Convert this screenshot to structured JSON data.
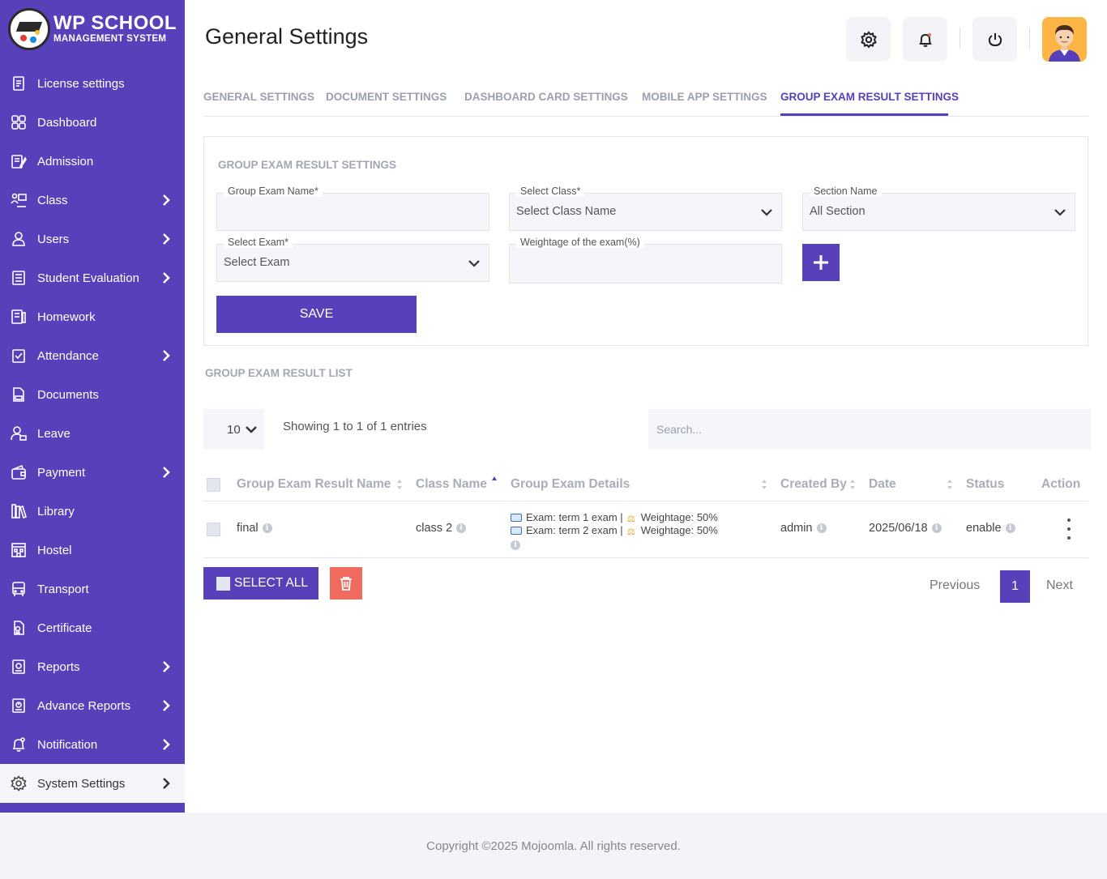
{
  "brand": {
    "title": "WP SCHOOL",
    "subtitle": "MANAGEMENT SYSTEM",
    "accent_color": "#5840bb"
  },
  "sidebar": {
    "items": [
      {
        "label": "License settings",
        "icon": "license-icon",
        "has_children": false
      },
      {
        "label": "Dashboard",
        "icon": "dashboard-icon",
        "has_children": false
      },
      {
        "label": "Admission",
        "icon": "admission-icon",
        "has_children": false
      },
      {
        "label": "Class",
        "icon": "class-icon",
        "has_children": true
      },
      {
        "label": "Users",
        "icon": "user-icon",
        "has_children": true
      },
      {
        "label": "Student Evaluation",
        "icon": "evaluation-icon",
        "has_children": true
      },
      {
        "label": "Homework",
        "icon": "homework-icon",
        "has_children": false
      },
      {
        "label": "Attendance",
        "icon": "attendance-icon",
        "has_children": true
      },
      {
        "label": "Documents",
        "icon": "document-icon",
        "has_children": false
      },
      {
        "label": "Leave",
        "icon": "leave-icon",
        "has_children": false
      },
      {
        "label": "Payment",
        "icon": "wallet-icon",
        "has_children": true
      },
      {
        "label": "Library",
        "icon": "library-icon",
        "has_children": false
      },
      {
        "label": "Hostel",
        "icon": "hostel-icon",
        "has_children": false
      },
      {
        "label": "Transport",
        "icon": "bus-icon",
        "has_children": false
      },
      {
        "label": "Certificate",
        "icon": "certificate-icon",
        "has_children": false
      },
      {
        "label": "Reports",
        "icon": "report-icon",
        "has_children": true
      },
      {
        "label": "Advance Reports",
        "icon": "advance-report-icon",
        "has_children": true
      },
      {
        "label": "Notification",
        "icon": "notification-icon",
        "has_children": true
      },
      {
        "label": "System Settings",
        "icon": "gear-icon",
        "has_children": true,
        "active": true
      }
    ]
  },
  "header": {
    "title": "General Settings"
  },
  "tabs": [
    {
      "label": "GENERAL SETTINGS"
    },
    {
      "label": "DOCUMENT SETTINGS"
    },
    {
      "label": "DASHBOARD CARD SETTINGS"
    },
    {
      "label": "MOBILE APP SETTINGS"
    },
    {
      "label": "GROUP EXAM RESULT SETTINGS",
      "active": true
    }
  ],
  "form": {
    "heading": "GROUP EXAM RESULT SETTINGS",
    "group_exam_name": {
      "label": "Group Exam Name*",
      "value": ""
    },
    "select_class": {
      "label": "Select Class*",
      "value": "Select Class Name"
    },
    "section_name": {
      "label": "Section Name",
      "value": "All Section"
    },
    "select_exam": {
      "label": "Select Exam*",
      "value": "Select Exam"
    },
    "weightage": {
      "label": "Weightage of the exam(%)",
      "value": ""
    },
    "save_label": "SAVE"
  },
  "list": {
    "heading": "GROUP EXAM RESULT LIST",
    "page_length": "10",
    "info": "Showing 1 to 1 of 1 entries",
    "search_placeholder": "Search...",
    "columns": [
      "Group Exam Result Name",
      "Class Name",
      "Group Exam Details",
      "Created By",
      "Date",
      "Status",
      "Action"
    ],
    "rows": [
      {
        "name": "final",
        "class_name": "class 2",
        "details": [
          {
            "exam": "Exam: term 1 exam |",
            "weightage": "Weightage: 50%"
          },
          {
            "exam": "Exam: term 2 exam |",
            "weightage": "Weightage: 50%"
          }
        ],
        "created_by": "admin",
        "date": "2025/06/18",
        "status": "enable"
      }
    ],
    "select_all_label": "SELECT ALL",
    "pagination": {
      "previous": "Previous",
      "current": "1",
      "next": "Next"
    }
  },
  "footer": {
    "copyright": "Copyright ©2025 Mojoomla. All rights reserved."
  }
}
